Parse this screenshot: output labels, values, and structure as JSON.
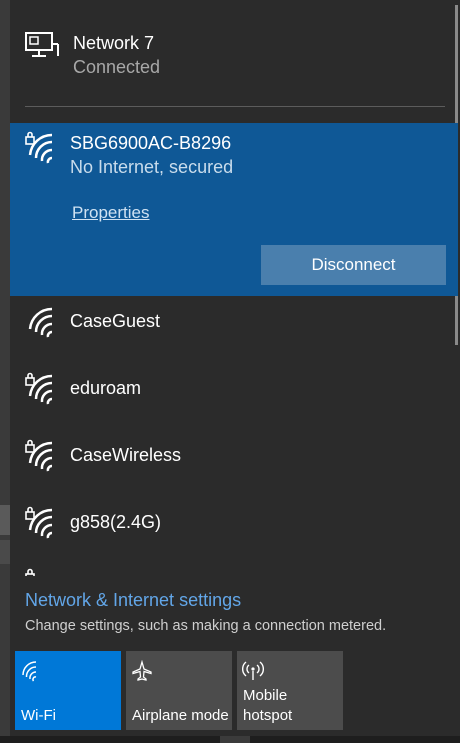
{
  "connected_network": {
    "name": "Network 7",
    "status": "Connected",
    "icon": "ethernet-monitor-icon"
  },
  "selected_network": {
    "ssid": "SBG6900AC-B8296",
    "status": "No Internet, secured",
    "properties_label": "Properties",
    "disconnect_label": "Disconnect",
    "icon": "wifi-secured-icon"
  },
  "networks": [
    {
      "ssid": "CaseGuest",
      "secured": false
    },
    {
      "ssid": "eduroam",
      "secured": true
    },
    {
      "ssid": "CaseWireless",
      "secured": true
    },
    {
      "ssid": "g858(2.4G)",
      "secured": true
    }
  ],
  "settings": {
    "link": "Network & Internet settings",
    "description": "Change settings, such as making a connection metered."
  },
  "quick_actions": [
    {
      "label": "Wi-Fi",
      "icon": "wifi-icon",
      "active": true
    },
    {
      "label": "Airplane mode",
      "icon": "airplane-icon",
      "active": false
    },
    {
      "label": "Mobile\nhotspot",
      "icon": "hotspot-icon",
      "active": false
    }
  ],
  "colors": {
    "panel_bg": "#2b2b2b",
    "selected_bg": "#0f5896",
    "accent": "#0078d7",
    "link": "#62a6e8"
  }
}
